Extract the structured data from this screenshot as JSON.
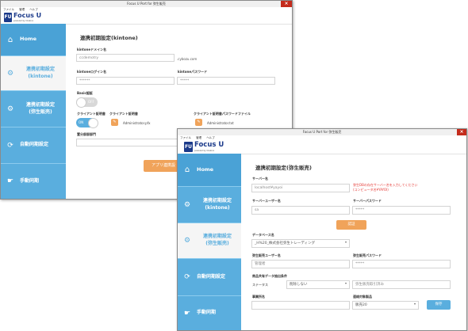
{
  "colors": {
    "sidebar": "#5aaede",
    "accent_orange": "#f0a35a",
    "close": "#c42b1c",
    "brand": "#1b3a8a",
    "error": "#e53935"
  },
  "win1": {
    "title": "Focus U Port for 弥生販売",
    "close": "×",
    "menu": [
      "ファイル",
      "管理",
      "ヘルプ"
    ],
    "logo": {
      "mark": "FU",
      "name": "Focus U",
      "tagline": "powered by Onebox"
    },
    "sidebar": [
      {
        "label": "Home",
        "icon": "home-icon"
      },
      {
        "label": "連携初期設定\n(kintone)",
        "icon": "gear-icon"
      },
      {
        "label": "連携初期設定\n(弥生販売)",
        "icon": "gear-icon"
      },
      {
        "label": "自動同期設定",
        "icon": "sync-icon"
      },
      {
        "label": "手動同期",
        "icon": "hand-icon"
      }
    ],
    "form": {
      "title": "連携初期設定(kintone)",
      "domain_label": "kintoneドメイン名",
      "domain_value": "ccdemotry",
      "domain_suffix": ".cybozu.com",
      "login_label": "kintoneログイン名",
      "login_value": "******",
      "password_label": "kintoneパスワード",
      "password_value": "*****",
      "basic_label": "Basic認証",
      "basic_toggle": "OFF",
      "client_label": "クライアント証明書",
      "client_toggle": "ON",
      "client_file_label": "クライアント証明書",
      "client_file_value": "Administrator.pfx",
      "client_pw_label": "クライアント証明書パスワードファイル",
      "client_pw_value": "Administrator.txt",
      "dept_label": "置分部部部門",
      "apply_button": "アプリ連携設"
    }
  },
  "win2": {
    "title": "Focus U Port for 弥生販売",
    "close": "×",
    "menu": [
      "ファイル",
      "管理",
      "ヘルプ"
    ],
    "logo": {
      "mark": "FU",
      "name": "Focus U",
      "tagline": "powered by Onebox"
    },
    "sidebar": [
      {
        "label": "Home",
        "icon": "home-icon"
      },
      {
        "label": "連携初期設定\n(kintone)",
        "icon": "gear-icon"
      },
      {
        "label": "連携初期設定\n(弥生販売)",
        "icon": "gear-icon"
      },
      {
        "label": "自動同期設定",
        "icon": "sync-icon"
      },
      {
        "label": "手動同期",
        "icon": "hand-icon"
      }
    ],
    "form": {
      "title": "連携初期設定(弥生販売)",
      "server_label": "サーバー名",
      "server_value": "localhost¥yayoi",
      "server_error": "弥生DBの存在サーバー名を入力してください",
      "server_error2": "(コンピュータ名¥YAYOI)",
      "server_user_label": "サーバーユーザー名",
      "server_user_value": "sa",
      "server_pw_label": "サーバーパスワード",
      "server_pw_value": "*****",
      "auth_button": "認証",
      "db_label": "データベース名",
      "db_value": "_H%20_株式会社弥生トレーディング",
      "yayoi_user_label": "弥生販売ユーザー名",
      "yayoi_user_value": "管理者",
      "yayoi_pw_label": "弥生販売パスワード",
      "yayoi_pw_value": "*****",
      "cond_label": "商品共有データ抽出条件",
      "status_label": "ステータス",
      "status_value": "削除しない",
      "status_text": "弥生販売取引済み",
      "office_label": "事業所名",
      "target_label": "連絡対象製品",
      "target_value": "販売20",
      "save_button": "保存"
    }
  }
}
